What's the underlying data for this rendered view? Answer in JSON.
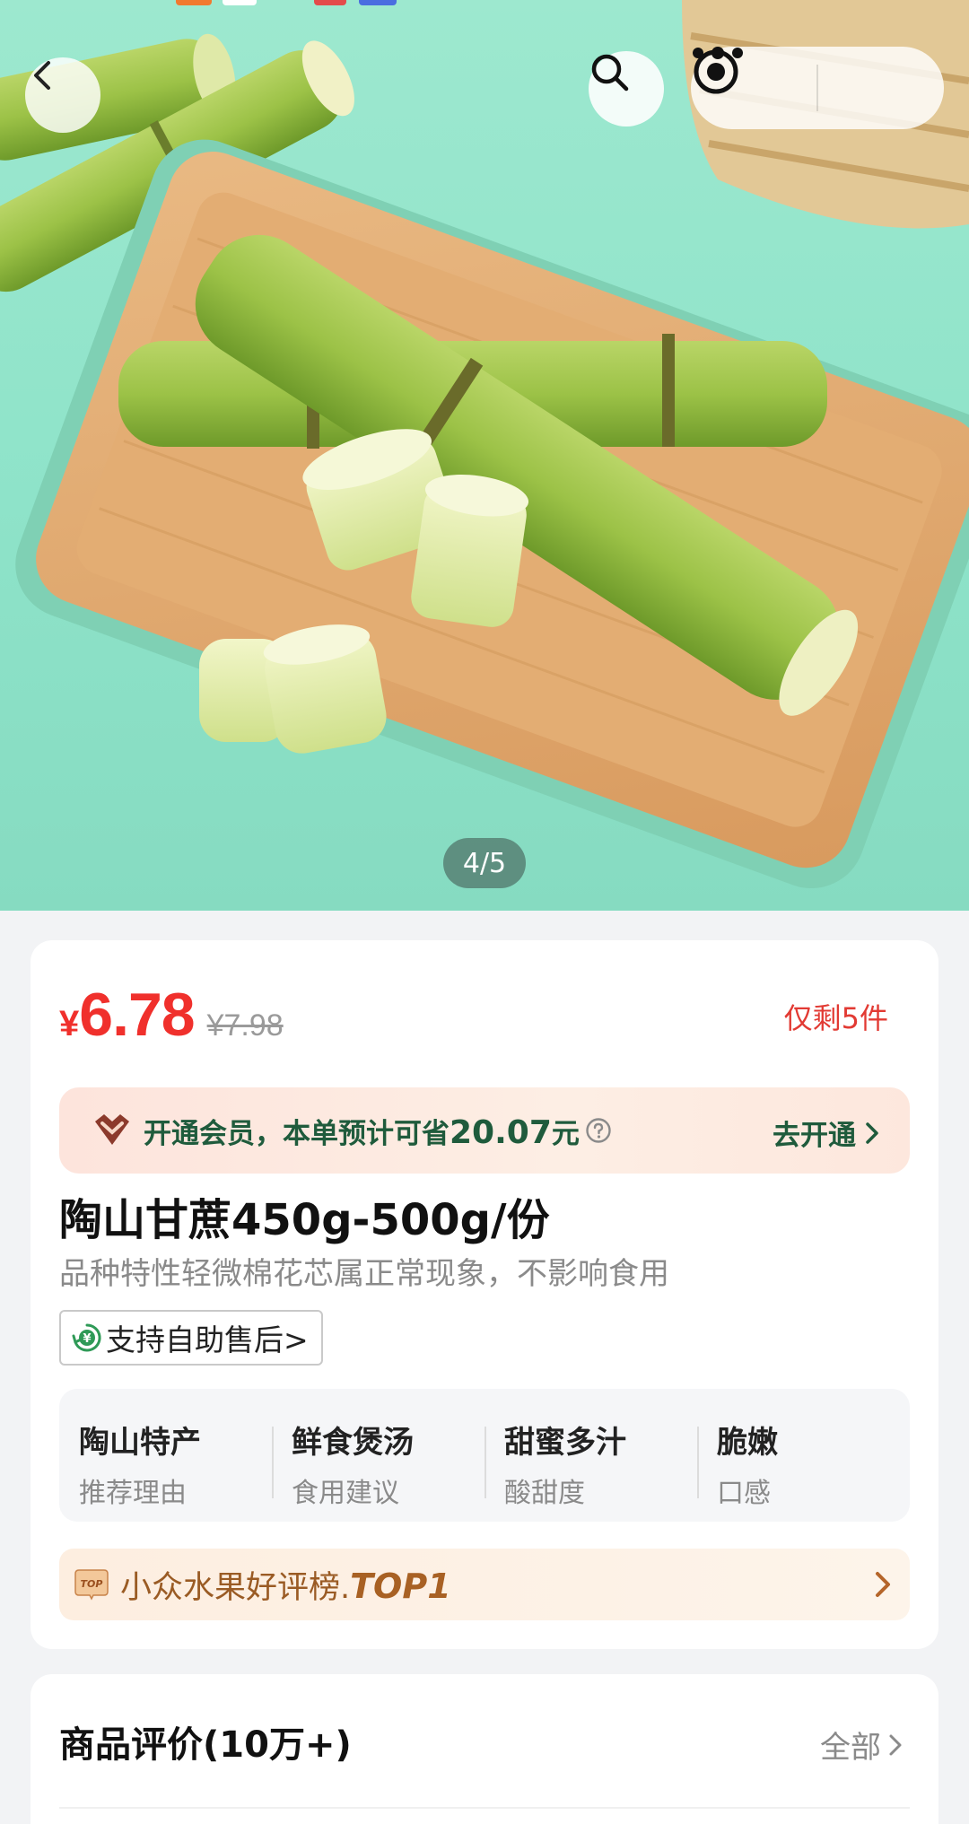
{
  "gallery": {
    "page_indicator": "4/5",
    "current_page": 4,
    "total_pages": 5
  },
  "top_nav": {
    "back_icon": "chevron-left-icon",
    "search_icon": "search-icon",
    "more_icon": "ellipsis-icon",
    "miniapp_icon": "target-icon"
  },
  "product": {
    "currency": "¥",
    "price": "6.78",
    "original_price": "¥7.98",
    "stock_notice": "仅剩5件",
    "title": "陶山甘蔗450g-500g/份",
    "subtitle": "品种特性轻微棉花芯属正常现象，不影响食用",
    "after_sale": "支持自助售后>"
  },
  "membership": {
    "prefix": "开通会员，本单预计可省",
    "saving": "20.07",
    "unit": "元",
    "cta": "去开通",
    "accent_color": "#1f5b3c"
  },
  "attributes": [
    {
      "value": "陶山特产",
      "label": "推荐理由"
    },
    {
      "value": "鲜食煲汤",
      "label": "食用建议"
    },
    {
      "value": "甜蜜多汁",
      "label": "酸甜度"
    },
    {
      "value": "脆嫩",
      "label": "口感"
    }
  ],
  "ranking": {
    "badge": "TOP",
    "text": "小众水果好评榜.",
    "rank": "TOP1"
  },
  "reviews": {
    "title": "商品评价(10万+)",
    "all_label": "全部"
  },
  "colors": {
    "price_red": "#f0302c",
    "hero_bg": "#8ee3c9"
  }
}
